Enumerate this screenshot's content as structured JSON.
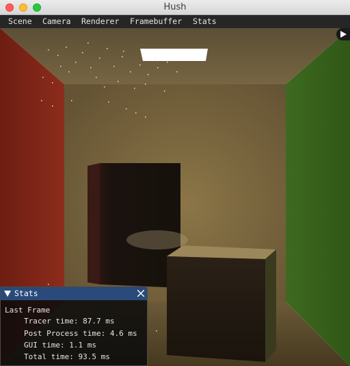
{
  "window": {
    "title": "Hush"
  },
  "menu": [
    "Scene",
    "Camera",
    "Renderer",
    "Framebuffer",
    "Stats"
  ],
  "stats": {
    "title": "Stats",
    "section": "Last Frame",
    "lines": [
      "Tracer time: 87.7 ms",
      "Post Process time: 4.6 ms",
      "GUI time: 1.1 ms",
      "Total time: 93.5 ms"
    ]
  },
  "icons": {
    "collapse": "play-triangle-icon",
    "panel_toggle": "triangle-down-icon",
    "panel_close": "close-icon"
  },
  "colors": {
    "menubar": "#262626",
    "panel_header": "#294a7a",
    "left_wall": "#8a2418",
    "right_wall": "#3a6a1c",
    "back_wall": "#8f7a4c"
  }
}
